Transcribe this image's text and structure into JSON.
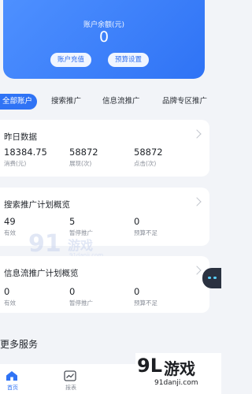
{
  "balance": {
    "title": "账户余额(元)",
    "value": "0",
    "recharge_button": "账户充值",
    "budget_button": "预算设置"
  },
  "tabs": [
    {
      "label": "全部账户",
      "active": true
    },
    {
      "label": "搜索推广",
      "active": false
    },
    {
      "label": "信息流推广",
      "active": false
    },
    {
      "label": "品牌专区推广",
      "active": false
    }
  ],
  "yesterday": {
    "title": "昨日数据",
    "stats": [
      {
        "value": "18384.75",
        "label": "消费(元)"
      },
      {
        "value": "58872",
        "label": "展现(次)"
      },
      {
        "value": "58872",
        "label": "点击(次)"
      }
    ]
  },
  "search_plan": {
    "title": "搜索推广计划概览",
    "stats": [
      {
        "value": "49",
        "label": "有效"
      },
      {
        "value": "5",
        "label": "暂停推广"
      },
      {
        "value": "0",
        "label": "预算不足"
      }
    ]
  },
  "feed_plan": {
    "title": "信息流推广计划概览",
    "stats": [
      {
        "value": "0",
        "label": "有效"
      },
      {
        "value": "0",
        "label": "暂停推广"
      },
      {
        "value": "0",
        "label": "预算不足"
      }
    ]
  },
  "more_services": "更多服务",
  "bottom_nav": [
    {
      "label": "首页",
      "icon": "home-icon",
      "active": true
    },
    {
      "label": "报表",
      "icon": "chart-icon",
      "active": false
    }
  ],
  "watermarks": {
    "mid_logo": "91",
    "mid_text": "游戏",
    "mid_url": "91danji.com",
    "brand_logo": "9L",
    "brand_text": "游戏",
    "brand_url": "91danji.com"
  },
  "colors": {
    "accent": "#2f73f5",
    "background": "#f2f4f8"
  }
}
